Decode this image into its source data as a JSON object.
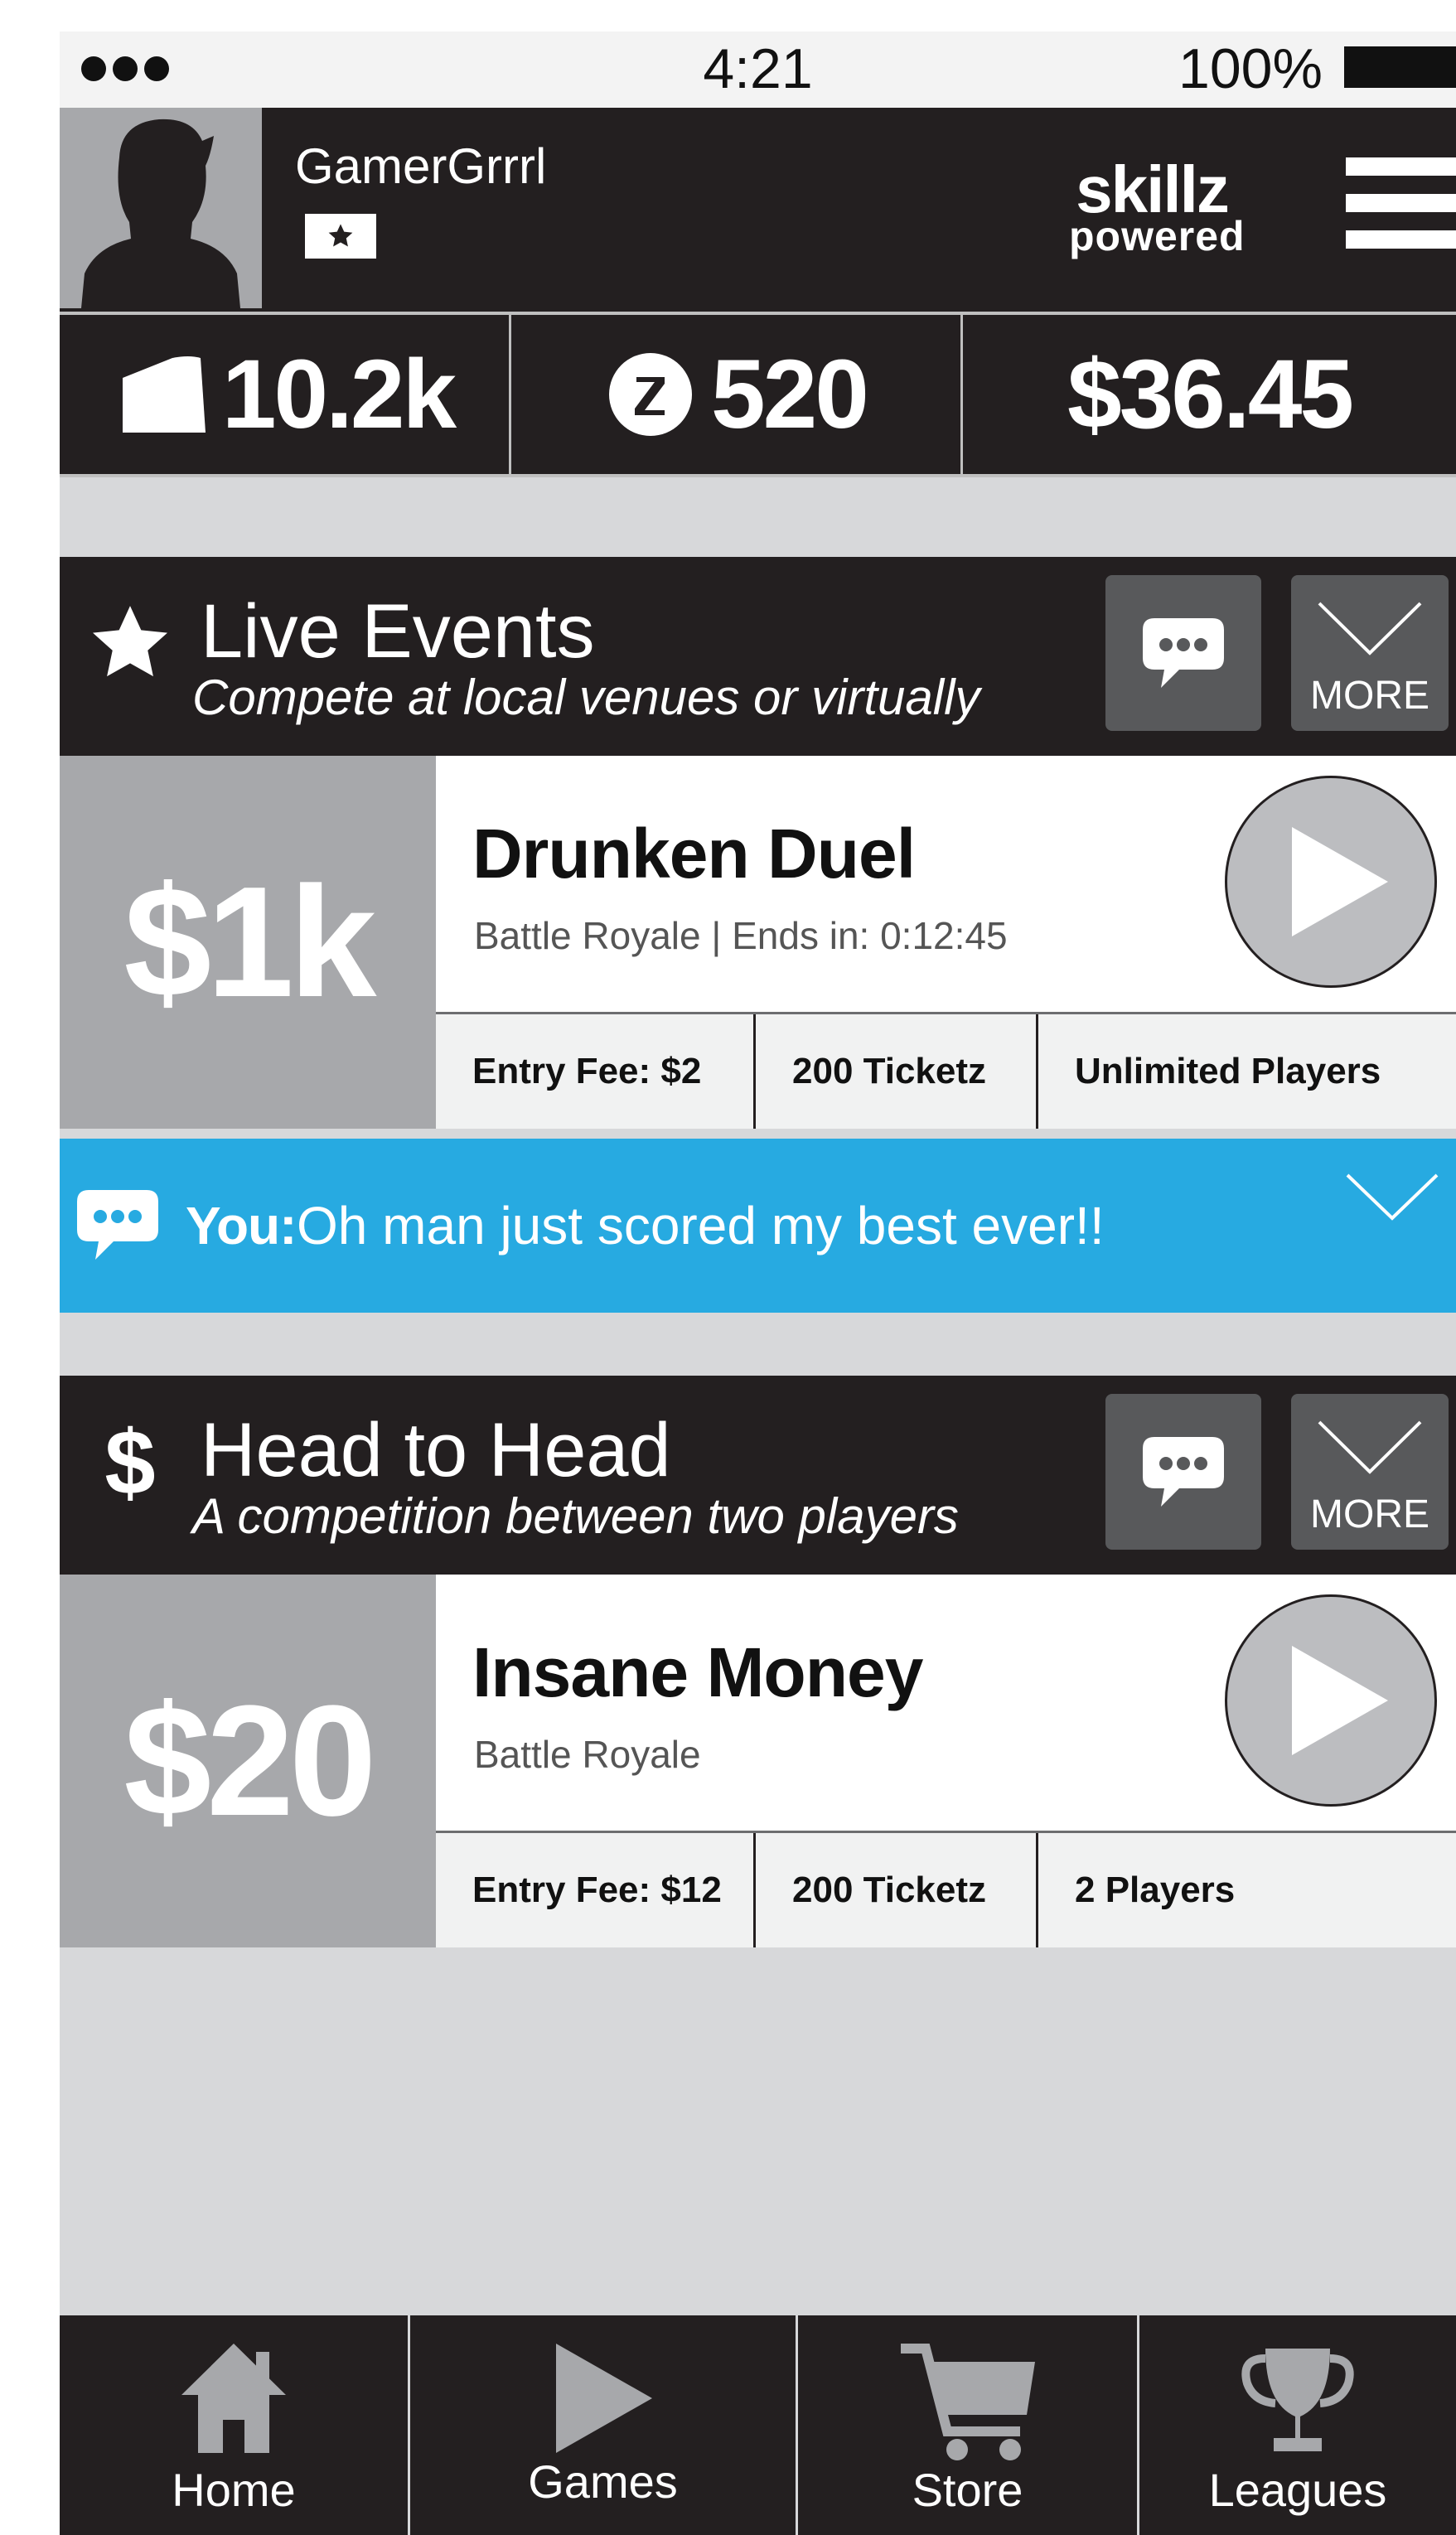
{
  "status_bar": {
    "time": "4:21",
    "battery": "100%"
  },
  "header": {
    "username": "GamerGrrrl",
    "logo_line1": "skillz",
    "logo_line2": "powered"
  },
  "stats": {
    "tickets": "10.2k",
    "z_coins": "520",
    "cash": "$36.45"
  },
  "live_events": {
    "title": "Live Events",
    "subtitle": "Compete at local venues or virtually",
    "more_label": "MORE",
    "event": {
      "prize": "$1k",
      "name": "Drunken Duel",
      "meta": "Battle Royale | Ends in: 0:12:45",
      "entry_fee": "Entry Fee: $2",
      "ticketz": "200 Ticketz",
      "players": "Unlimited Players"
    }
  },
  "chat": {
    "who": "You:",
    "message": "Oh man just scored my best ever!!"
  },
  "head_to_head": {
    "title": "Head to Head",
    "subtitle": "A competition between two players",
    "more_label": "MORE",
    "event": {
      "prize": "$20",
      "name": "Insane Money",
      "meta": "Battle Royale",
      "entry_fee": "Entry Fee: $12",
      "ticketz": "200 Ticketz",
      "players": "2 Players"
    }
  },
  "nav": [
    {
      "label": "Home",
      "icon": "home-icon"
    },
    {
      "label": "Games",
      "icon": "play-icon"
    },
    {
      "label": "Store",
      "icon": "cart-icon"
    },
    {
      "label": "Leagues",
      "icon": "trophy-icon"
    }
  ],
  "colors": {
    "dark": "#231f20",
    "grey_tile": "#a7a8ab",
    "button_grey": "#58595b",
    "chat_blue": "#27aae1",
    "background": "#d7d8da"
  }
}
